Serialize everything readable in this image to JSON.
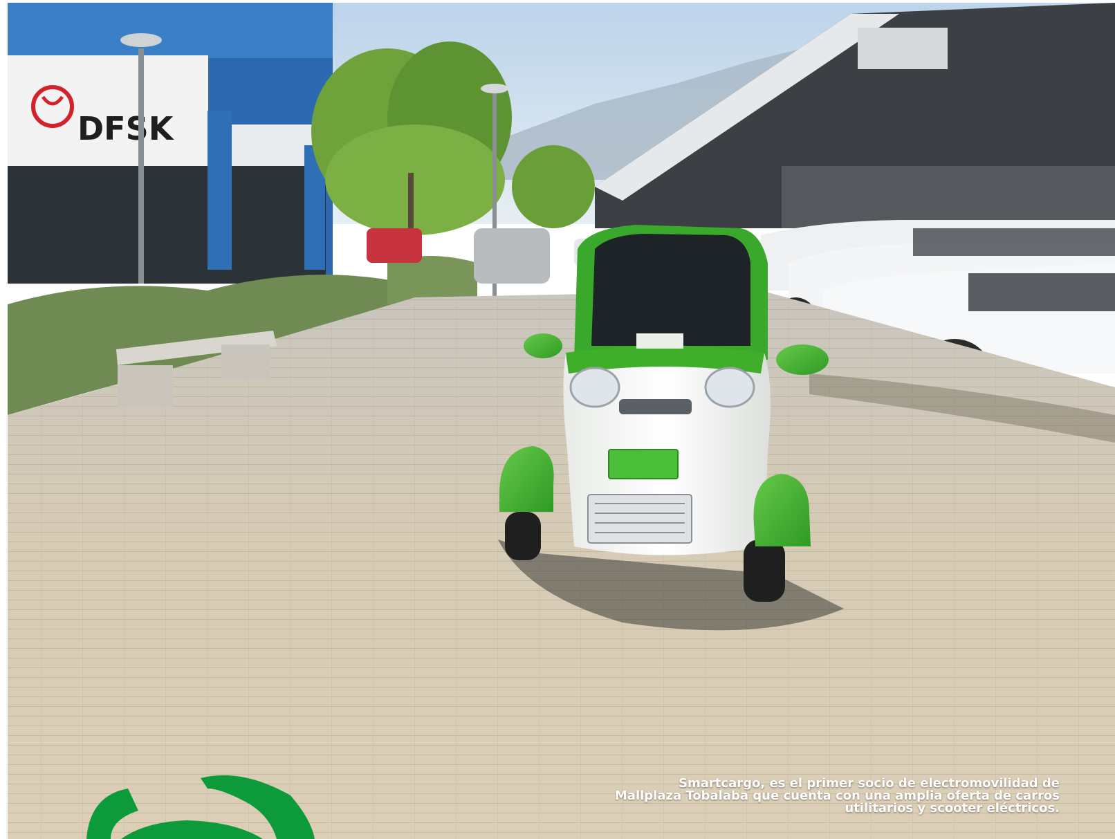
{
  "photo": {
    "description_icon": "photograph",
    "storefront_sign": "DFSK",
    "brand_colors": {
      "vehicle_green": "#3fae2a",
      "vehicle_white": "#f4f5f2",
      "storefront_blue": "#2f6fb5",
      "logo_green": "#0c9a3a",
      "sky": "#cfe0ee",
      "pavement": "#d8cdb7"
    }
  },
  "caption": {
    "line1": "Smartcargo, es el primer socio de electromovilidad de",
    "line2": "Mallplaza Tobalaba que cuenta con una amplia oferta de carros",
    "line3": "utilitarios y scooter eléctricos."
  }
}
